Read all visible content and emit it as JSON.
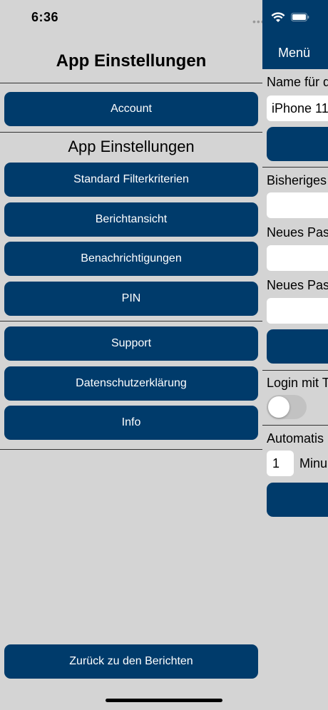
{
  "status": {
    "time": "6:36",
    "dots": "•••"
  },
  "left": {
    "title": "App Einstellungen",
    "account_label": "Account",
    "section_title": "App Einstellungen",
    "buttons": {
      "filter": "Standard Filterkriterien",
      "report_view": "Berichtansicht",
      "notifications": "Benachrichtigungen",
      "pin": "PIN",
      "support": "Support",
      "privacy": "Datenschutzerklärung",
      "info": "Info",
      "back": "Zurück zu den Berichten"
    }
  },
  "right": {
    "header_title": "Menü",
    "device_name_label": "Name für d",
    "device_name_value": "iPhone 11",
    "old_password_label": "Bisheriges",
    "new_password_label": "Neues Pas",
    "new_password_repeat_label": "Neues Pas",
    "login_label": "Login mit T",
    "auto_label": "Automatis",
    "minutes_value": "1",
    "minutes_label": "Minu"
  },
  "colors": {
    "accent": "#003b6b",
    "background": "#d4d4d4"
  },
  "toggle": {
    "on": false
  }
}
